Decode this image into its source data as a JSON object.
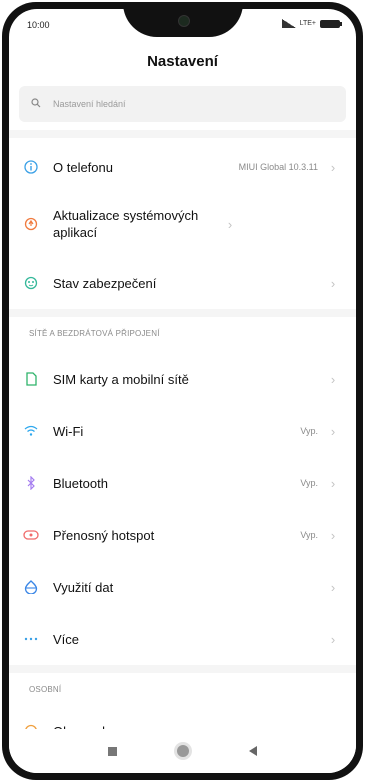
{
  "status": {
    "time": "10:00",
    "network": "LTE+"
  },
  "header": {
    "title": "Nastavení"
  },
  "search": {
    "placeholder": "Nastavení hledání"
  },
  "sections": {
    "connections": "SÍTĚ A BEZDRÁTOVÁ PŘIPOJENÍ",
    "personal": "OSOBNÍ"
  },
  "items": {
    "about": {
      "label": "O telefonu",
      "value": "MIUI Global 10.3.11",
      "icon": "info-icon",
      "color": "#3aa0e6"
    },
    "updates": {
      "label": "Aktualizace systémových aplikací",
      "icon": "update-icon",
      "color": "#f07b3f"
    },
    "security": {
      "label": "Stav zabezpečení",
      "icon": "shield-icon",
      "color": "#35b89a"
    },
    "sim": {
      "label": "SIM karty a mobilní sítě",
      "icon": "sim-icon",
      "color": "#2fb36b"
    },
    "wifi": {
      "label": "Wi-Fi",
      "value": "Vyp.",
      "icon": "wifi-icon",
      "color": "#2ea8ee"
    },
    "bluetooth": {
      "label": "Bluetooth",
      "value": "Vyp.",
      "icon": "bluetooth-icon",
      "color": "#a47cf0"
    },
    "hotspot": {
      "label": "Přenosný hotspot",
      "value": "Vyp.",
      "icon": "hotspot-icon",
      "color": "#f06a6a"
    },
    "data": {
      "label": "Využití dat",
      "icon": "data-usage-icon",
      "color": "#3a86e6"
    },
    "more": {
      "label": "Více",
      "icon": "more-icon",
      "color": "#3aa0e6"
    },
    "display": {
      "label": "Obrazovka",
      "icon": "display-icon",
      "color": "#f0a03f"
    }
  }
}
